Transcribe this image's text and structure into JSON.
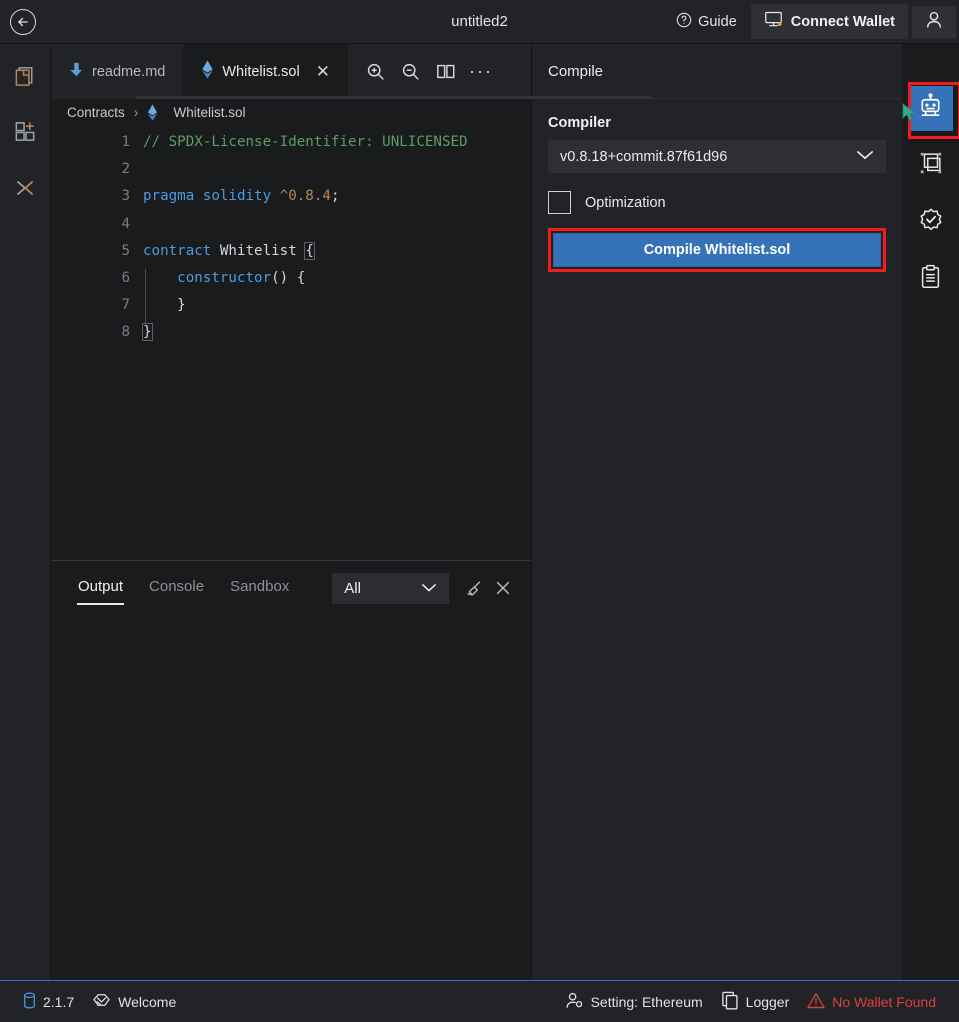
{
  "header": {
    "title": "untitled2",
    "back_icon": "back-arrow-icon",
    "guide_label": "Guide",
    "guide_icon": "question-circle-icon",
    "wallet_label": "Connect Wallet",
    "wallet_icon": "monitor-wallet-icon",
    "avatar_icon": "user-avatar-icon"
  },
  "left_rail": [
    {
      "name": "file-explorer",
      "icon": "files-stack-icon"
    },
    {
      "name": "plugin-manager",
      "icon": "grid-plus-icon"
    },
    {
      "name": "terminal-toggle",
      "icon": "chevrons-icon"
    }
  ],
  "tabs": [
    {
      "label": "readme.md",
      "icon": "markdown-down-arrow-icon",
      "active": false,
      "closable": false
    },
    {
      "label": "Whitelist.sol",
      "icon": "ethereum-diamond-icon",
      "active": true,
      "closable": true,
      "close_label": "✕"
    }
  ],
  "tab_tools": [
    {
      "name": "zoom-in",
      "icon": "magnifier-plus-icon"
    },
    {
      "name": "zoom-out",
      "icon": "magnifier-minus-icon"
    },
    {
      "name": "split-editor",
      "icon": "split-panes-icon"
    },
    {
      "name": "more-options",
      "icon": "ellipsis-icon",
      "glyph": "···"
    }
  ],
  "breadcrumb": {
    "root": "Contracts",
    "separator": "›",
    "file_icon": "ethereum-diamond-icon",
    "file": "Whitelist.sol"
  },
  "editor": {
    "language": "solidity",
    "lines": [
      {
        "n": "1",
        "tokens": [
          {
            "t": "// SPDX-License-Identifier: UNLICENSED",
            "c": "k-comment"
          }
        ]
      },
      {
        "n": "2",
        "tokens": []
      },
      {
        "n": "3",
        "tokens": [
          {
            "t": "pragma",
            "c": "k-key"
          },
          {
            "t": " ",
            "c": "k-punc"
          },
          {
            "t": "solidity",
            "c": "k-key"
          },
          {
            "t": " ",
            "c": "k-punc"
          },
          {
            "t": "^0.8.4",
            "c": "k-num"
          },
          {
            "t": ";",
            "c": "k-punc"
          }
        ]
      },
      {
        "n": "4",
        "tokens": []
      },
      {
        "n": "5",
        "tokens": [
          {
            "t": "contract",
            "c": "k-key"
          },
          {
            "t": " ",
            "c": "k-punc"
          },
          {
            "t": "Whitelist",
            "c": "k-name"
          },
          {
            "t": " ",
            "c": "k-punc"
          },
          {
            "t": "{",
            "c": "k-punc brkt"
          }
        ]
      },
      {
        "n": "6",
        "tokens": [
          {
            "t": "    ",
            "c": "k-punc"
          },
          {
            "t": "constructor",
            "c": "k-key"
          },
          {
            "t": "() {",
            "c": "k-punc"
          }
        ]
      },
      {
        "n": "7",
        "tokens": [
          {
            "t": "    }",
            "c": "k-punc"
          }
        ]
      },
      {
        "n": "8",
        "tokens": [
          {
            "t": "}",
            "c": "k-punc brkt"
          }
        ]
      }
    ]
  },
  "terminal": {
    "tabs": [
      {
        "label": "Output",
        "active": true
      },
      {
        "label": "Console",
        "active": false
      },
      {
        "label": "Sandbox",
        "active": false
      }
    ],
    "filter_value": "All",
    "filter_chevron_icon": "chevron-down-icon",
    "clear_icon": "broom-clear-icon",
    "close_icon": "close-x-icon",
    "log_lines": []
  },
  "right_panel": {
    "title": "Compile",
    "compiler_label": "Compiler",
    "compiler_version": "v0.8.18+commit.87f61d96",
    "compiler_chevron_icon": "chevron-down-icon",
    "optimization_label": "Optimization",
    "optimization_checked": false,
    "compile_button_label": "Compile Whitelist.sol",
    "highlight_color": "#f51b1b",
    "accent_color": "#3572b8"
  },
  "right_rail": [
    {
      "name": "solidity-compiler",
      "icon": "robot-icon",
      "active": true
    },
    {
      "name": "deploy-run-transactions",
      "icon": "deploy-square-icon",
      "active": false
    },
    {
      "name": "contract-verification",
      "icon": "badge-check-icon",
      "active": false
    },
    {
      "name": "clipboard-tasks",
      "icon": "clipboard-list-icon",
      "active": false
    }
  ],
  "statusbar": {
    "version_icon": "database-icon",
    "version": "2.1.7",
    "welcome_icon": "handshake-icon",
    "welcome_label": "Welcome",
    "setting_icon": "user-settings-icon",
    "setting_label": "Setting: Ethereum",
    "logger_icon": "copy-pages-icon",
    "logger_label": "Logger",
    "warning_icon": "warning-triangle-icon",
    "warning_label": "No Wallet Found",
    "warning_color": "#d94040"
  }
}
